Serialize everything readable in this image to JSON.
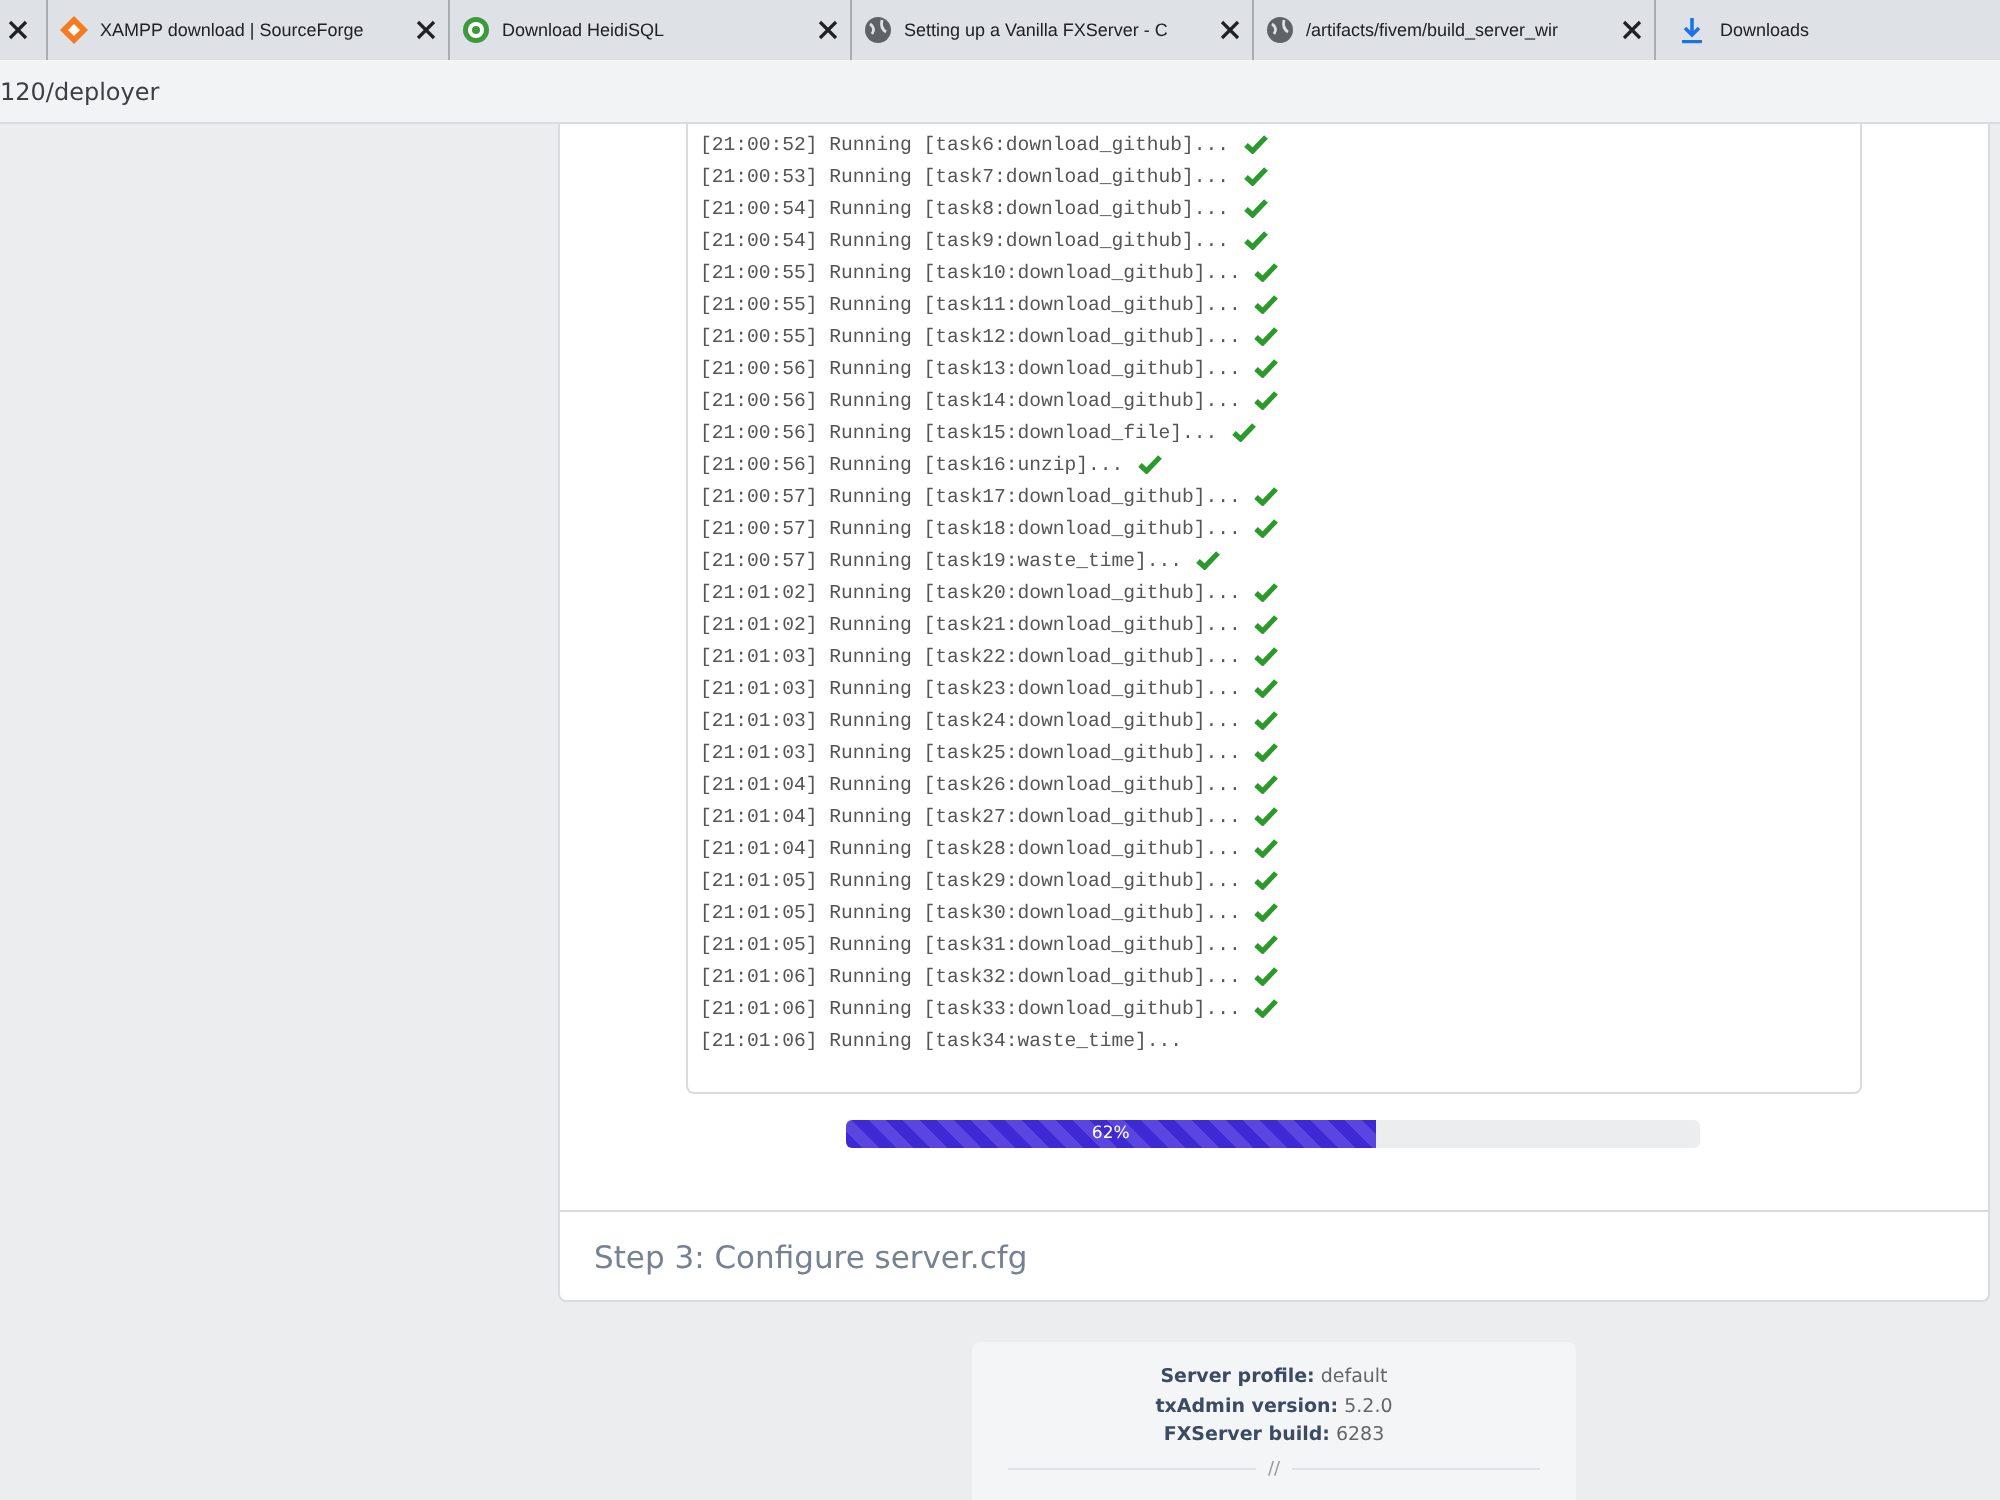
{
  "browser": {
    "tabs": [
      {
        "kind": "clipped",
        "selected": false
      },
      {
        "kind": "page",
        "title": "XAMPP download | SourceForge",
        "selected": false
      },
      {
        "kind": "page",
        "title": "Download HeidiSQL",
        "selected": false
      },
      {
        "kind": "page",
        "title": "Setting up a Vanilla FXServer - C",
        "selected": false
      },
      {
        "kind": "page",
        "title": "/artifacts/fivem/build_server_wir",
        "selected": false
      },
      {
        "kind": "bookmark",
        "title": "Downloads",
        "selected": false
      }
    ],
    "address": "120/deployer"
  },
  "log": [
    {
      "time": "[21:00:52]",
      "text": "Running [task6:download_github]...",
      "done": true
    },
    {
      "time": "[21:00:53]",
      "text": "Running [task7:download_github]...",
      "done": true
    },
    {
      "time": "[21:00:54]",
      "text": "Running [task8:download_github]...",
      "done": true
    },
    {
      "time": "[21:00:54]",
      "text": "Running [task9:download_github]...",
      "done": true
    },
    {
      "time": "[21:00:55]",
      "text": "Running [task10:download_github]...",
      "done": true
    },
    {
      "time": "[21:00:55]",
      "text": "Running [task11:download_github]...",
      "done": true
    },
    {
      "time": "[21:00:55]",
      "text": "Running [task12:download_github]...",
      "done": true
    },
    {
      "time": "[21:00:56]",
      "text": "Running [task13:download_github]...",
      "done": true
    },
    {
      "time": "[21:00:56]",
      "text": "Running [task14:download_github]...",
      "done": true
    },
    {
      "time": "[21:00:56]",
      "text": "Running [task15:download_file]...",
      "done": true
    },
    {
      "time": "[21:00:56]",
      "text": "Running [task16:unzip]...",
      "done": true
    },
    {
      "time": "[21:00:57]",
      "text": "Running [task17:download_github]...",
      "done": true
    },
    {
      "time": "[21:00:57]",
      "text": "Running [task18:download_github]...",
      "done": true
    },
    {
      "time": "[21:00:57]",
      "text": "Running [task19:waste_time]...",
      "done": true
    },
    {
      "time": "[21:01:02]",
      "text": "Running [task20:download_github]...",
      "done": true
    },
    {
      "time": "[21:01:02]",
      "text": "Running [task21:download_github]...",
      "done": true
    },
    {
      "time": "[21:01:03]",
      "text": "Running [task22:download_github]...",
      "done": true
    },
    {
      "time": "[21:01:03]",
      "text": "Running [task23:download_github]...",
      "done": true
    },
    {
      "time": "[21:01:03]",
      "text": "Running [task24:download_github]...",
      "done": true
    },
    {
      "time": "[21:01:03]",
      "text": "Running [task25:download_github]...",
      "done": true
    },
    {
      "time": "[21:01:04]",
      "text": "Running [task26:download_github]...",
      "done": true
    },
    {
      "time": "[21:01:04]",
      "text": "Running [task27:download_github]...",
      "done": true
    },
    {
      "time": "[21:01:04]",
      "text": "Running [task28:download_github]...",
      "done": true
    },
    {
      "time": "[21:01:05]",
      "text": "Running [task29:download_github]...",
      "done": true
    },
    {
      "time": "[21:01:05]",
      "text": "Running [task30:download_github]...",
      "done": true
    },
    {
      "time": "[21:01:05]",
      "text": "Running [task31:download_github]...",
      "done": true
    },
    {
      "time": "[21:01:06]",
      "text": "Running [task32:download_github]...",
      "done": true
    },
    {
      "time": "[21:01:06]",
      "text": "Running [task33:download_github]...",
      "done": true
    },
    {
      "time": "[21:01:06]",
      "text": "Running [task34:waste_time]...",
      "done": false
    }
  ],
  "progress": {
    "level": 0.62,
    "label": "62%"
  },
  "next_step": "Step 3: Configure server.cfg",
  "footer": {
    "info": [
      {
        "label": "Server profile:",
        "value": "default"
      },
      {
        "label": "txAdmin version:",
        "value": "5.2.0"
      },
      {
        "label": "FXServer build:",
        "value": "6283"
      }
    ],
    "divider": "//"
  }
}
